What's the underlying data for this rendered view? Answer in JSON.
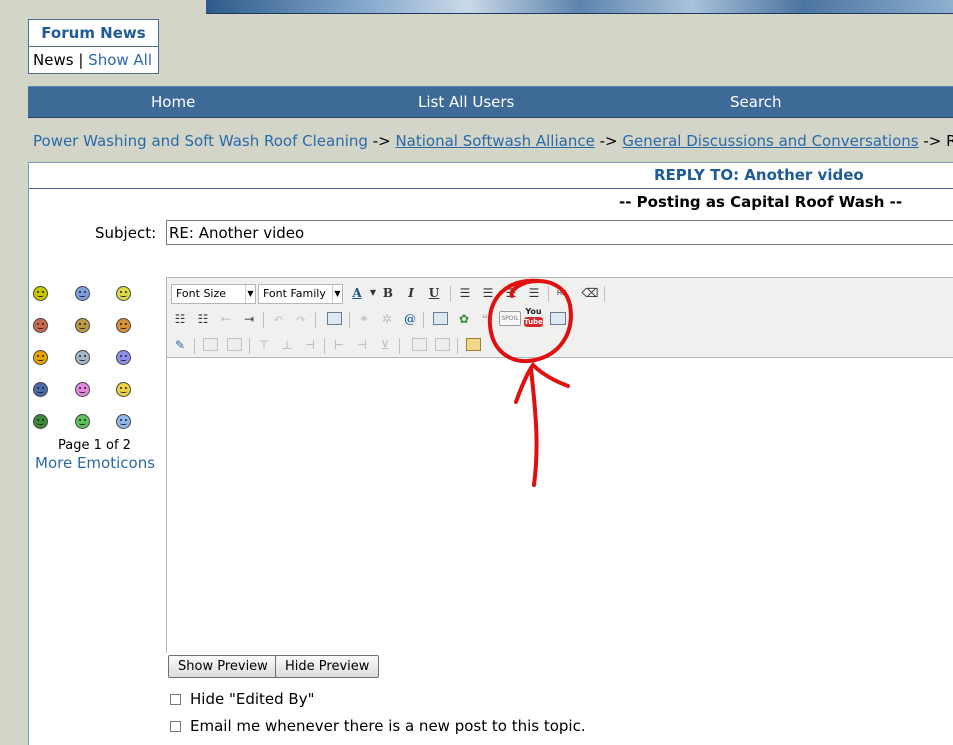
{
  "forum_news": {
    "title": "Forum News",
    "news": "News",
    "separator": "|",
    "show_all": "Show All"
  },
  "nav": {
    "home": "Home",
    "list_users": "List All Users",
    "search": "Search"
  },
  "breadcrumb": {
    "root": "Power Washing and Soft Wash Roof Cleaning",
    "arrow": "->",
    "forum": "National Softwash Alliance",
    "section": "General Discussions and Conversations",
    "current": "RE"
  },
  "reply": {
    "title": "REPLY TO: Another video",
    "posting_as": "-- Posting as Capital Roof Wash --",
    "subject_label": "Subject:",
    "subject_value": "RE: Another video"
  },
  "emoticons": {
    "page": "Page 1 of 2",
    "more": "More Emoticons",
    "colors": [
      "#c8c800",
      "#7f9fe0",
      "#d9d94a",
      "#c96a50",
      "#b89a4a",
      "#d9903a",
      "#e8a400",
      "#a8b8c8",
      "#8f8fe8",
      "#4a6aa8",
      "#e08ae0",
      "#f0d040",
      "#3a8a3a",
      "#5cc05c",
      "#8fb8e8"
    ]
  },
  "editor": {
    "font_size": "Font Size",
    "font_family": "Font Family",
    "bold": "B",
    "italic": "I",
    "underline": "U",
    "hr": "HR",
    "spoil": "SPOIL",
    "youtube_you": "You",
    "youtube_tube": "Tube"
  },
  "buttons": {
    "show_preview": "Show Preview",
    "hide_preview": "Hide Preview"
  },
  "options": {
    "hide_edited": "Hide \"Edited By\"",
    "email_me": "Email me whenever there is a new post to this topic."
  },
  "colors": {
    "nav_bg": "#3e6a97",
    "link": "#2a6aa8",
    "title": "#1f5b94",
    "annotation": "#e01010"
  }
}
